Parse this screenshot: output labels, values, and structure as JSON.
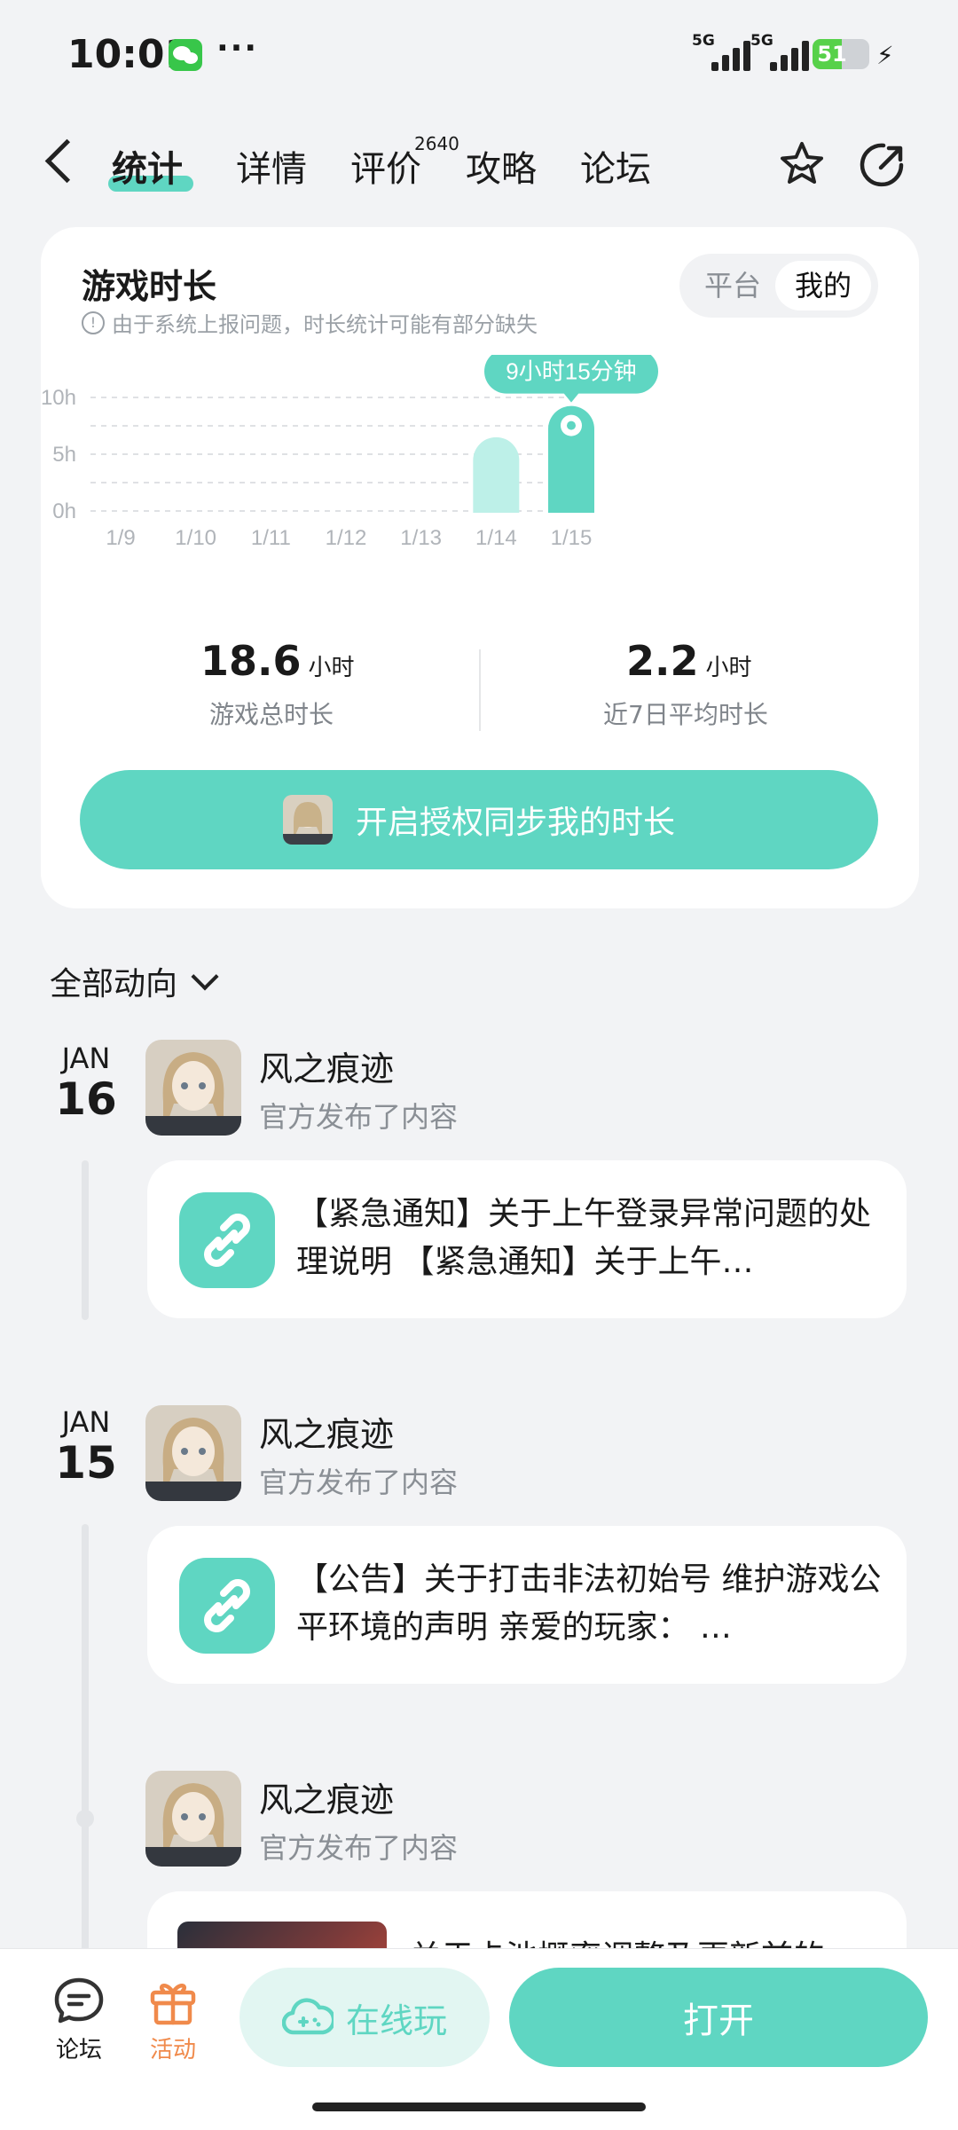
{
  "status_bar": {
    "time": "10:01",
    "network1": "5G",
    "network2": "5G",
    "battery": "51",
    "battery_level": 0.51
  },
  "nav": {
    "tabs": [
      "统计",
      "详情",
      "评价",
      "攻略",
      "论坛"
    ],
    "active_tab": "统计",
    "review_count": "2640"
  },
  "playtime": {
    "title": "游戏时长",
    "notice": "由于系统上报问题，时长统计可能有部分缺失",
    "toggle": {
      "platform": "平台",
      "mine": "我的",
      "selected": "我的"
    },
    "tooltip": "9小时15分钟",
    "stats": {
      "total_value": "18.6",
      "total_unit": "小时",
      "total_label": "游戏总时长",
      "avg_value": "2.2",
      "avg_unit": "小时",
      "avg_label": "近7日平均时长"
    },
    "cta": "开启授权同步我的时长"
  },
  "chart_data": {
    "type": "bar",
    "categories": [
      "1/9",
      "1/10",
      "1/11",
      "1/12",
      "1/13",
      "1/14",
      "1/15"
    ],
    "values": [
      0,
      0,
      0,
      0,
      0,
      6.5,
      9.25
    ],
    "y_ticks": [
      "10h",
      "5h",
      "0h"
    ],
    "ylim": [
      0,
      10
    ],
    "grid": true,
    "highlight_index": 6,
    "colors": {
      "normal": "#bdf0e8",
      "highlight": "#5fd6c2"
    }
  },
  "feed": {
    "filter_label": "全部动向",
    "items": [
      {
        "month": "JAN",
        "day": "16",
        "author": "风之痕迹",
        "action": "官方发布了内容",
        "text": "【紧急通知】关于上午登录异常问题的处理说明 【紧急通知】关于上午…"
      },
      {
        "month": "JAN",
        "day": "15",
        "author": "风之痕迹",
        "action": "官方发布了内容",
        "text": "【公告】关于打击非法初始号 维护游戏公平环境的声明 亲爱的玩家： …"
      },
      {
        "author": "风之痕迹",
        "action": "官方发布了内容",
        "text": "关于卡池概率调整及更新前的…"
      }
    ]
  },
  "bottom_bar": {
    "forum": "论坛",
    "activity": "活动",
    "play_online": "在线玩",
    "open": "打开"
  },
  "colors": {
    "accent": "#5fd6c2",
    "activity": "#f08a4b"
  }
}
